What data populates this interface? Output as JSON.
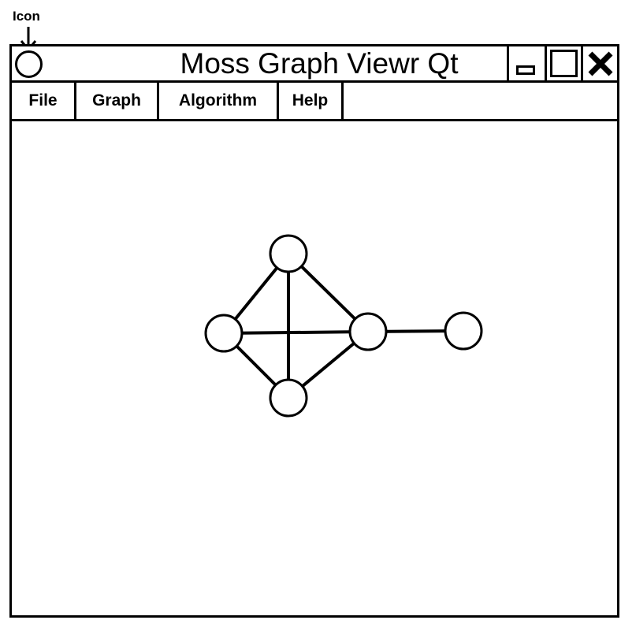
{
  "annotation": {
    "label": "Icon"
  },
  "window": {
    "title": "Moss Graph Viewr Qt",
    "controls": {
      "minimize": "minimize-icon",
      "maximize": "maximize-icon",
      "close": "close-icon"
    }
  },
  "menu": {
    "items": [
      {
        "label": "File"
      },
      {
        "label": "Graph"
      },
      {
        "label": "Algorithm"
      },
      {
        "label": "Help"
      }
    ]
  },
  "graph": {
    "nodes": [
      {
        "id": "top"
      },
      {
        "id": "left"
      },
      {
        "id": "right"
      },
      {
        "id": "bottom"
      },
      {
        "id": "far-right"
      }
    ],
    "edges": [
      [
        "top",
        "left"
      ],
      [
        "top",
        "right"
      ],
      [
        "top",
        "bottom"
      ],
      [
        "left",
        "right"
      ],
      [
        "left",
        "bottom"
      ],
      [
        "right",
        "bottom"
      ],
      [
        "right",
        "far-right"
      ]
    ]
  }
}
